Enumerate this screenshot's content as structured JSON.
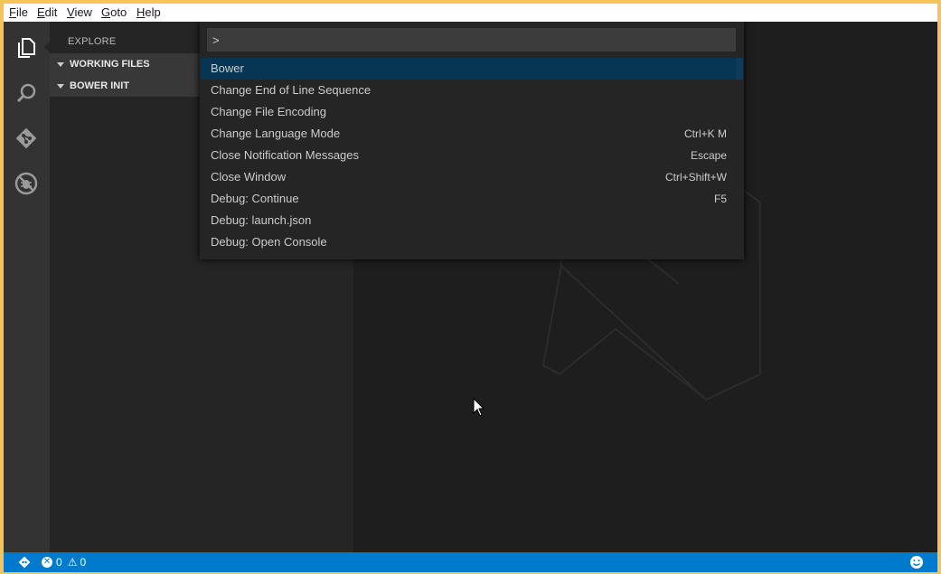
{
  "menubar": {
    "items": [
      {
        "label": "File",
        "mnemonic": "F",
        "rest": "ile"
      },
      {
        "label": "Edit",
        "mnemonic": "E",
        "rest": "dit"
      },
      {
        "label": "View",
        "mnemonic": "V",
        "rest": "iew"
      },
      {
        "label": "Goto",
        "mnemonic": "G",
        "rest": "oto"
      },
      {
        "label": "Help",
        "mnemonic": "H",
        "rest": "elp"
      }
    ]
  },
  "activitybar": {
    "icons": [
      "files-icon",
      "search-icon",
      "git-icon",
      "debug-icon"
    ]
  },
  "sidebar": {
    "title": "EXPLORE",
    "sections": [
      {
        "label": "WORKING FILES"
      },
      {
        "label": "BOWER INIT"
      }
    ]
  },
  "quick_open": {
    "input_value": ">",
    "items": [
      {
        "label": "Bower",
        "key": "",
        "selected": true
      },
      {
        "label": "Change End of Line Sequence",
        "key": ""
      },
      {
        "label": "Change File Encoding",
        "key": ""
      },
      {
        "label": "Change Language Mode",
        "key": "Ctrl+K M"
      },
      {
        "label": "Close Notification Messages",
        "key": "Escape"
      },
      {
        "label": "Close Window",
        "key": "Ctrl+Shift+W"
      },
      {
        "label": "Debug: Continue",
        "key": "F5"
      },
      {
        "label": "Debug: launch.json",
        "key": ""
      },
      {
        "label": "Debug: Open Console",
        "key": ""
      }
    ]
  },
  "statusbar": {
    "errors": "0",
    "warnings": "0"
  },
  "colors": {
    "window_border": "#f3c45a",
    "statusbar": "#007acc",
    "selection": "#073655"
  }
}
